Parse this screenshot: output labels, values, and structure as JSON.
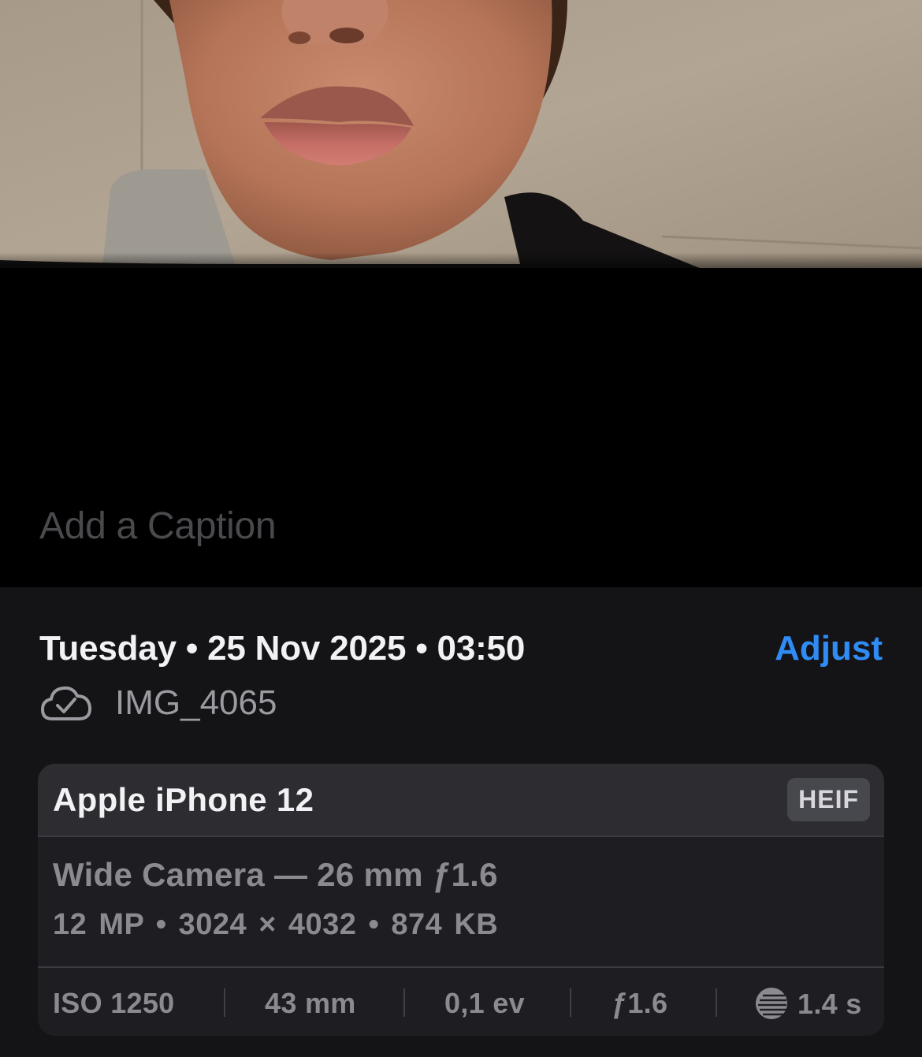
{
  "caption_placeholder": "Add a Caption",
  "info": {
    "date_line": "Tuesday • 25 Nov 2025 • 03:50",
    "adjust_label": "Adjust",
    "cloud_icon": "icloud-check-icon",
    "filename": "IMG_4065"
  },
  "camera": {
    "device": "Apple iPhone 12",
    "format_badge": "HEIF",
    "lens": "Wide Camera — 26 mm ƒ1.6",
    "specs": "12 MP • 3024 × 4032 • 874 KB",
    "exif": {
      "iso": "ISO 1250",
      "focal": "43 mm",
      "ev": "0,1 ev",
      "aperture": "ƒ1.6",
      "shutter": "1.4 s",
      "shutter_icon": "shutter-speed-icon"
    }
  },
  "colors": {
    "accent": "#2f8cf5",
    "panel_bg": "#141417",
    "card_bg": "#1e1e22",
    "card_head_bg": "#2c2c31"
  }
}
